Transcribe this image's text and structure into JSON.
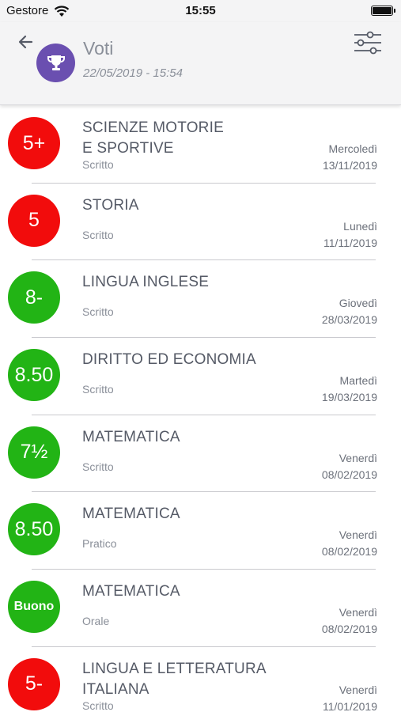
{
  "status": {
    "carrier": "Gestore",
    "time": "15:55"
  },
  "header": {
    "title": "Voti",
    "subtitle": "22/05/2019 - 15:54"
  },
  "colors": {
    "red": "#f20c0c",
    "green": "#22b415",
    "accent": "#6a4fb0"
  },
  "grades": [
    {
      "grade": "5+",
      "color": "red",
      "subject": [
        "SCIENZE MOTORIE",
        "E SPORTIVE"
      ],
      "type": "Scritto",
      "day": "Mercoledì",
      "date": "13/11/2019"
    },
    {
      "grade": "5",
      "color": "red",
      "subject": [
        "STORIA"
      ],
      "type": "Scritto",
      "day": "Lunedì",
      "date": "11/11/2019"
    },
    {
      "grade": "8-",
      "color": "green",
      "subject": [
        "LINGUA INGLESE"
      ],
      "type": "Scritto",
      "day": "Giovedì",
      "date": "28/03/2019"
    },
    {
      "grade": "8.50",
      "color": "green",
      "subject": [
        "DIRITTO ED ECONOMIA"
      ],
      "type": "Scritto",
      "day": "Martedì",
      "date": "19/03/2019"
    },
    {
      "grade": "7½",
      "color": "green",
      "subject": [
        "MATEMATICA"
      ],
      "type": "Scritto",
      "day": "Venerdì",
      "date": "08/02/2019"
    },
    {
      "grade": "8.50",
      "color": "green",
      "subject": [
        "MATEMATICA"
      ],
      "type": "Pratico",
      "day": "Venerdì",
      "date": "08/02/2019"
    },
    {
      "grade": "Buono",
      "color": "green",
      "subject": [
        "MATEMATICA"
      ],
      "type": "Orale",
      "day": "Venerdì",
      "date": "08/02/2019"
    },
    {
      "grade": "5-",
      "color": "red",
      "subject": [
        "LINGUA E LETTERATURA",
        "ITALIANA"
      ],
      "type": "Scritto",
      "day": "Venerdì",
      "date": "11/01/2019"
    }
  ]
}
